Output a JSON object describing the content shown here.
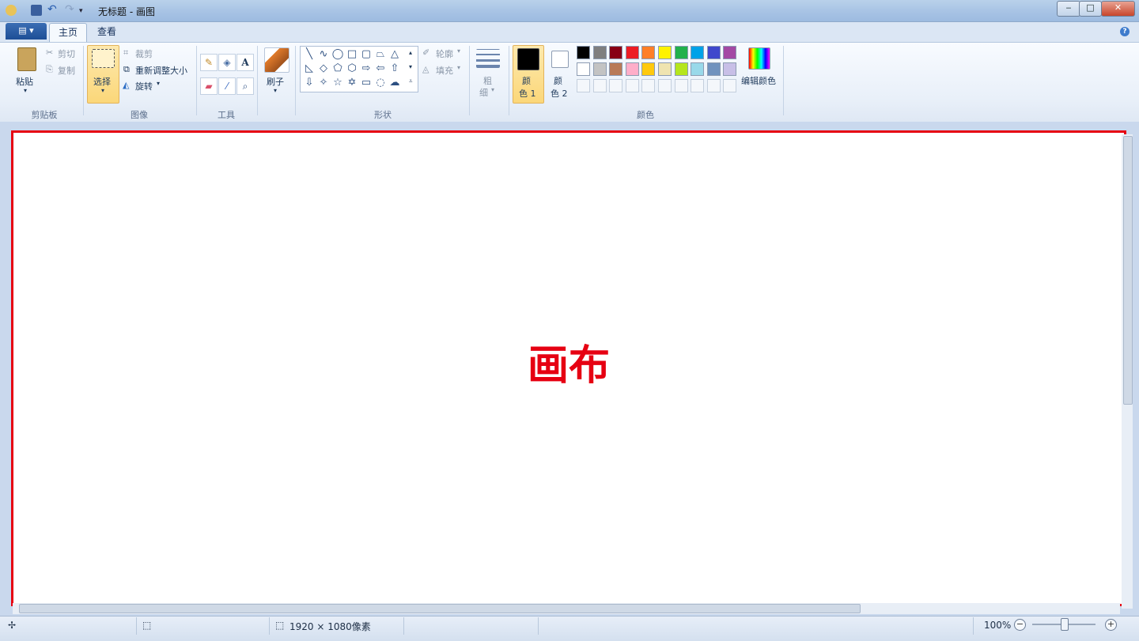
{
  "window": {
    "title": "无标题 - 画图",
    "controls": {
      "minimize": "‒",
      "maximize": "□",
      "close": "✕"
    }
  },
  "tabs": [
    {
      "label": "主页",
      "active": true
    },
    {
      "label": "查看",
      "active": false
    }
  ],
  "ribbon": {
    "clipboard": {
      "label": "剪贴板",
      "paste": "粘贴",
      "cut": "剪切",
      "copy": "复制"
    },
    "image": {
      "label": "图像",
      "select": "选择",
      "crop": "裁剪",
      "resize": "重新调整大小",
      "rotate": "旋转"
    },
    "tools": {
      "label": "工具"
    },
    "brush": {
      "label": "刷子"
    },
    "shapes": {
      "label": "形状",
      "outline": "轮廓",
      "fill": "填充"
    },
    "size": {
      "label_line1": "粗",
      "label_line2": "细"
    },
    "colors": {
      "label": "颜色",
      "color1": "颜色 1",
      "color1_line1": "颜",
      "color1_line2": "色 1",
      "color2_line1": "颜",
      "color2_line2": "色 2",
      "edit_colors": "编辑颜色",
      "palette_row1": [
        "#000000",
        "#7f7f7f",
        "#880015",
        "#ed1c24",
        "#ff7f27",
        "#fff200",
        "#22b14c",
        "#00a2e8",
        "#3f48cc",
        "#a349a4"
      ],
      "palette_row2": [
        "#ffffff",
        "#c3c3c3",
        "#b97a57",
        "#ffaec9",
        "#ffc90e",
        "#efe4b0",
        "#b5e61d",
        "#99d9ea",
        "#7092be",
        "#c8bfe7"
      ]
    }
  },
  "canvas": {
    "annotation": "画布"
  },
  "statusbar": {
    "size": "1920 × 1080像素",
    "zoom": "100%"
  }
}
